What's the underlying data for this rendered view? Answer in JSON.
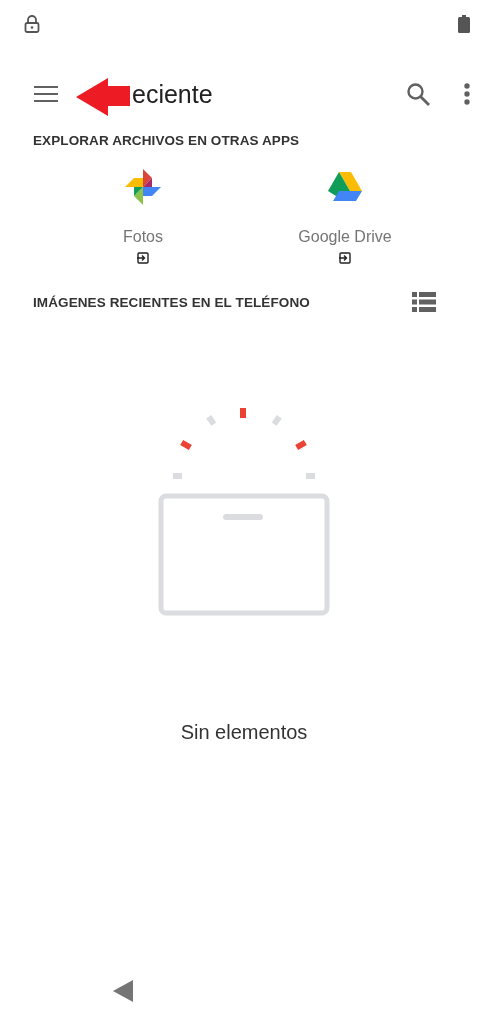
{
  "toolbar": {
    "title": "eciente"
  },
  "sections": [
    {
      "title": "EXPLORAR ARCHIVOS EN OTRAS APPS"
    },
    {
      "title": "IMÁGENES RECIENTES EN EL TELÉFONO"
    }
  ],
  "apps": [
    {
      "kind": "photos",
      "label": "Fotos"
    },
    {
      "kind": "drive",
      "label": "Google Drive"
    }
  ],
  "empty_state": {
    "message": "Sin elementos"
  }
}
